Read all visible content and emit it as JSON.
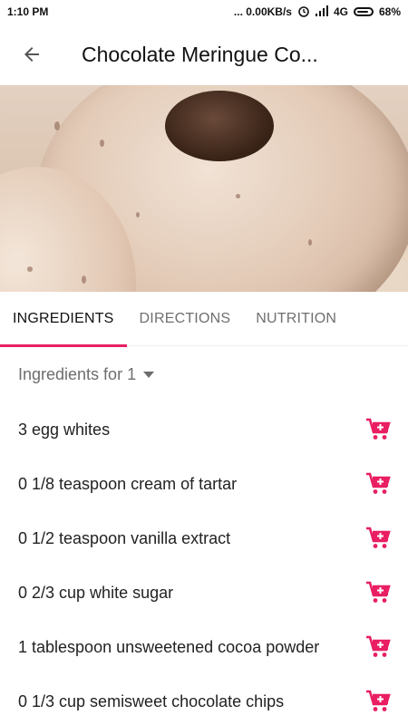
{
  "status_bar": {
    "time": "1:10 PM",
    "network_speed": "... 0.00KB/s",
    "signal_label": "4G",
    "battery_percent": "68%",
    "battery_level": 0.68
  },
  "app_bar": {
    "title": "Chocolate Meringue Co..."
  },
  "tabs": [
    {
      "label": "INGREDIENTS",
      "active": true
    },
    {
      "label": "DIRECTIONS",
      "active": false
    },
    {
      "label": "NUTRITION",
      "active": false
    }
  ],
  "ingredients": {
    "servings_label": "Ingredients for 1",
    "items": [
      {
        "text": "3 egg whites"
      },
      {
        "text": "0 1/8 teaspoon cream of tartar"
      },
      {
        "text": "0 1/2 teaspoon vanilla extract"
      },
      {
        "text": "0 2/3 cup white sugar"
      },
      {
        "text": "1 tablespoon unsweetened cocoa powder"
      },
      {
        "text": "0 1/3 cup semisweet chocolate chips"
      }
    ]
  },
  "colors": {
    "accent": "#e91e63"
  },
  "icons": {
    "back": "arrow-left",
    "cart": "add-to-cart"
  }
}
